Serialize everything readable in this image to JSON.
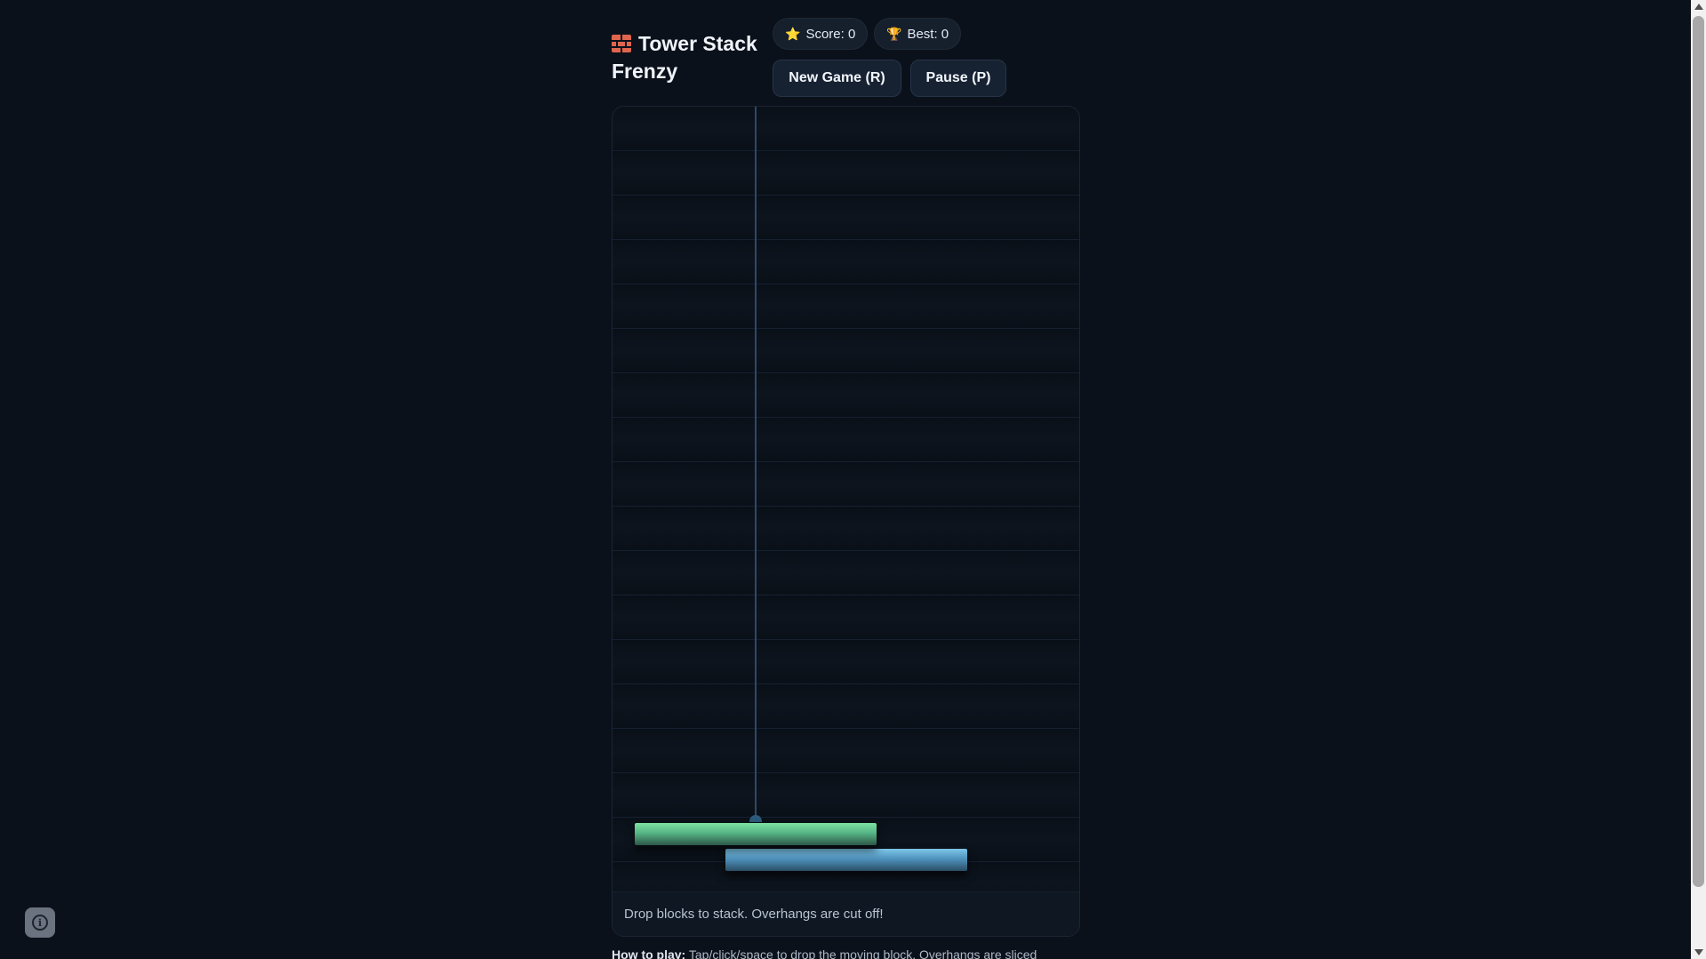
{
  "app": {
    "title": "Tower Stack Frenzy"
  },
  "stats": {
    "score_label": "Score: 0",
    "best_label": "Best: 0",
    "score": 0,
    "best": 0
  },
  "buttons": {
    "new_game": "New Game (R)",
    "pause": "Pause (P)"
  },
  "board": {
    "status_text": "Drop blocks to stack. Overhangs are cut off!",
    "colors": {
      "moving_block": "#56b585",
      "base_block": "#4f93bd",
      "background": "#0a1018"
    }
  },
  "howto": {
    "label": "How to play:",
    "text": "Tap/click/space to drop the moving block. Overhangs are sliced"
  },
  "icons": {
    "title": "brick-icon",
    "score": "star-icon",
    "best": "trophy-icon",
    "info": "info-icon"
  }
}
